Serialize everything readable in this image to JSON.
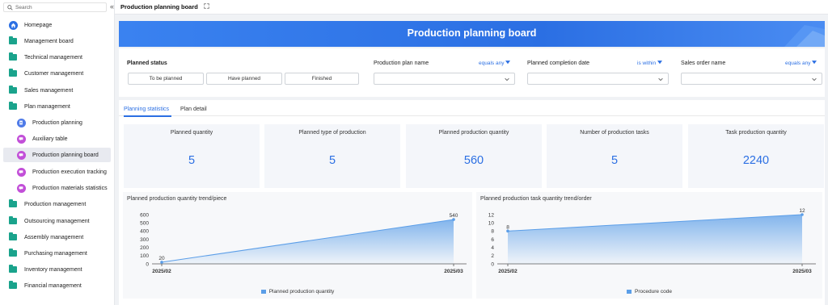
{
  "search": {
    "placeholder": "Search"
  },
  "sidebar": {
    "items": [
      {
        "label": "Homepage",
        "icon": "home-icon"
      },
      {
        "label": "Management board",
        "icon": "folder-icon"
      },
      {
        "label": "Technical management",
        "icon": "folder-icon"
      },
      {
        "label": "Customer management",
        "icon": "folder-icon"
      },
      {
        "label": "Sales management",
        "icon": "folder-icon"
      },
      {
        "label": "Plan management",
        "icon": "folder-icon"
      },
      {
        "label": "Production planning",
        "icon": "document-icon"
      },
      {
        "label": "Auxiliary table",
        "icon": "chat-icon"
      },
      {
        "label": "Production planning board",
        "icon": "chat-icon",
        "active": true
      },
      {
        "label": "Production execution tracking",
        "icon": "chat-icon"
      },
      {
        "label": "Production materials statistics",
        "icon": "chat-icon"
      },
      {
        "label": "Production management",
        "icon": "folder-icon"
      },
      {
        "label": "Outsourcing management",
        "icon": "folder-icon"
      },
      {
        "label": "Assembly management",
        "icon": "folder-icon"
      },
      {
        "label": "Purchasing management",
        "icon": "folder-icon"
      },
      {
        "label": "Inventory management",
        "icon": "folder-icon"
      },
      {
        "label": "Financial management",
        "icon": "folder-icon"
      }
    ]
  },
  "topbar": {
    "collapse_icon": "«",
    "tab_title": "Production planning board"
  },
  "banner": {
    "title": "Production planning board"
  },
  "filters": {
    "planned_status": {
      "label": "Planned status",
      "options": [
        "To be planned",
        "Have planned",
        "Finished"
      ]
    },
    "plan_name": {
      "label": "Production plan name",
      "operator": "equals any"
    },
    "completion_date": {
      "label": "Planned completion date",
      "operator": "is within"
    },
    "sales_order": {
      "label": "Sales order name",
      "operator": "equals any"
    }
  },
  "tabs": [
    "Planning statistics",
    "Plan detail"
  ],
  "stats": [
    {
      "label": "Planned quantity",
      "value": "5"
    },
    {
      "label": "Planned type of production",
      "value": "5"
    },
    {
      "label": "Planned production quantity",
      "value": "560"
    },
    {
      "label": "Number of production tasks",
      "value": "5"
    },
    {
      "label": "Task production quantity",
      "value": "2240"
    }
  ],
  "colors": {
    "accent": "#2b6fe3",
    "series": "#5b9ee8",
    "folder": "#1aa38c"
  },
  "chart_data": [
    {
      "type": "area",
      "title": "Planned production quantity trend/piece",
      "categories": [
        "2025/02",
        "2025/03"
      ],
      "series": [
        {
          "name": "Planned production quantity",
          "values": [
            20,
            540
          ]
        }
      ],
      "ylim": [
        0,
        600
      ],
      "yticks": [
        "0",
        "100",
        "200",
        "300",
        "400",
        "500",
        "600"
      ],
      "data_labels": [
        "20",
        "540"
      ]
    },
    {
      "type": "area",
      "title": "Planned production task quantity trend/order",
      "categories": [
        "2025/02",
        "2025/03"
      ],
      "series": [
        {
          "name": "Procedure code",
          "values": [
            8,
            12
          ]
        }
      ],
      "ylim": [
        0,
        12
      ],
      "yticks": [
        "0",
        "2",
        "4",
        "6",
        "8",
        "10",
        "12"
      ],
      "data_labels": [
        "8",
        "12"
      ]
    }
  ]
}
